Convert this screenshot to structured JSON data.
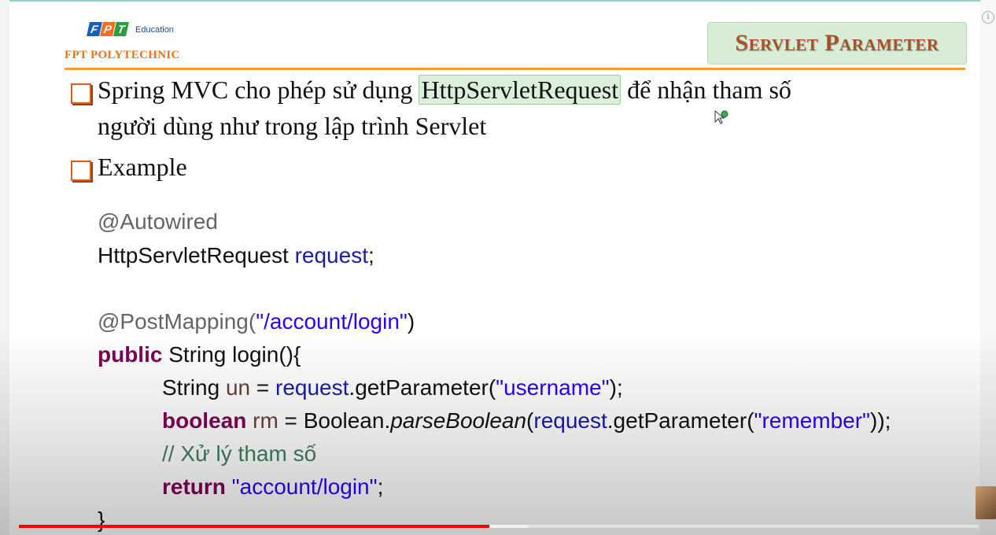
{
  "logo": {
    "letters": [
      "F",
      "P",
      "T"
    ],
    "sub": "Education",
    "school": "FPT POLYTECHNIC"
  },
  "title": "Servlet Parameter",
  "bullets": {
    "b1_pre": "Spring MVC cho phép sử dụng ",
    "b1_highlight": "HttpServletRequest",
    "b1_post": " để nhận tham số",
    "b1_line2": "người dùng như trong lập trình Servlet",
    "b2": "Example"
  },
  "code": {
    "l1": "@Autowired",
    "l2_type": "HttpServletRequest ",
    "l2_var": "request",
    "l2_end": ";",
    "l3_ann": "@PostMapping(",
    "l3_str": "\"/account/login\"",
    "l3_end": ")",
    "l4_kw": "public",
    "l4_rest": " String login(){",
    "l5_type": "String ",
    "l5_var": "un",
    "l5_eq": " = ",
    "l5_req": "request",
    "l5_call": ".getParameter(",
    "l5_str": "\"username\"",
    "l5_end": ");",
    "l6_kw": "boolean",
    "l6_var": " rm",
    "l6_eq": " = Boolean.",
    "l6_method": "parseBoolean",
    "l6_open": "(",
    "l6_req": "request",
    "l6_call": ".getParameter(",
    "l6_str": "\"remember\"",
    "l6_end": "));",
    "l7": "// Xử lý tham số",
    "l8_kw": "return",
    "l8_str": " \"account/login\"",
    "l8_end": ";",
    "l9": "}"
  },
  "player": {
    "progress_fraction": 0.49,
    "buffered_fraction": 0.53
  },
  "colors": {
    "accent_orange": "#f0a030",
    "title_color": "#a9502c",
    "progress_red": "#ff0000"
  }
}
